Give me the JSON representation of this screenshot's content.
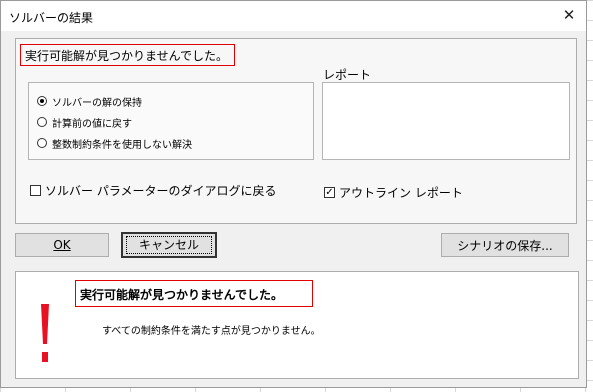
{
  "dialog": {
    "title": "ソルバーの結果",
    "close_symbol": "✕"
  },
  "top": {
    "status_text": "実行可能解が見つかりませんでした。",
    "options": [
      {
        "label": "ソルバーの解の保持",
        "checked": true
      },
      {
        "label": "計算前の値に戻す",
        "checked": false
      },
      {
        "label": "整数制約条件を使用しない解決",
        "checked": false
      }
    ],
    "report_label": "レポート",
    "return_dialog_label": "ソルバー パラメーターのダイアログに戻る",
    "return_dialog_checked": false,
    "outline_report_label": "アウトライン レポート",
    "outline_report_checked": true
  },
  "buttons": {
    "ok": "OK",
    "cancel": "キャンセル",
    "save_scenario": "シナリオの保存..."
  },
  "bottom": {
    "headline": "実行可能解が見つかりませんでした。",
    "detail": "すべての制約条件を満たす点が見つかりません。",
    "icon": "exclamation-icon",
    "icon_color": "#e81123"
  },
  "accent_colors": {
    "highlight_border": "#e00000"
  }
}
